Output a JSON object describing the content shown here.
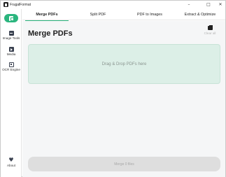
{
  "window": {
    "title": "FrugalFormat",
    "controls": {
      "minimize": "–",
      "maximize": "□",
      "close": "✕"
    }
  },
  "sidebar": {
    "items": [
      {
        "label": "Image Tools",
        "icon": "image-icon"
      },
      {
        "label": "Media",
        "icon": "media-icon"
      },
      {
        "label": "OCR Engine",
        "icon": "ocr-icon"
      }
    ],
    "about": {
      "label": "About",
      "icon": "heart-icon"
    }
  },
  "tabs": [
    {
      "label": "Merge PDFs",
      "active": true
    },
    {
      "label": "Split PDF",
      "active": false
    },
    {
      "label": "PDF to Images",
      "active": false
    },
    {
      "label": "Extract & Optimize",
      "active": false
    }
  ],
  "main": {
    "title": "Merge PDFs",
    "clear_all": "Clear all",
    "dropzone_text": "Drag & Drop PDFs here",
    "merge_button": "Merge 0 files"
  },
  "colors": {
    "accent": "#2bb57e",
    "dropzone_bg": "#dcefe7",
    "disabled_button": "#dedede"
  }
}
